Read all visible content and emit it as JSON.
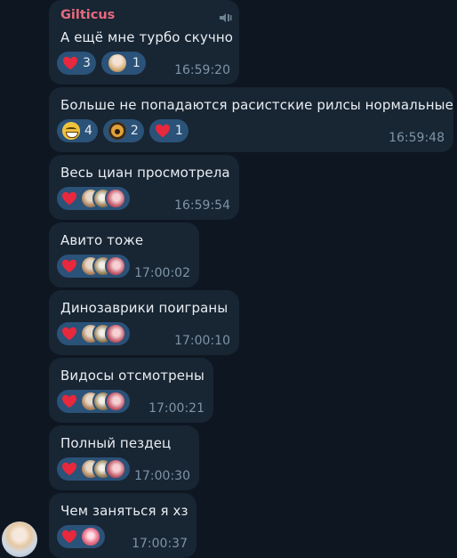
{
  "chat": {
    "sender_name": "Gilticus",
    "messages": [
      {
        "text": "А ещё мне турбо скучно",
        "time": "16:59:20",
        "reactions": [
          {
            "emoji": "heart",
            "count": "3"
          },
          {
            "emoji": "avatar-blonde",
            "count": "1"
          }
        ]
      },
      {
        "text": "Больше не попадаются расистские рилсы нормальные",
        "time": "16:59:48",
        "reactions": [
          {
            "emoji": "grinning-face",
            "count": "4"
          },
          {
            "emoji": "alarm-clock-face",
            "count": "2"
          },
          {
            "emoji": "heart",
            "count": "1"
          }
        ]
      },
      {
        "text": "Весь циан просмотрела",
        "time": "16:59:54",
        "reactions": [
          {
            "emoji": "heart",
            "users": 3
          }
        ]
      },
      {
        "text": "Авито тоже",
        "time": "17:00:02",
        "reactions": [
          {
            "emoji": "heart",
            "users": 3
          }
        ]
      },
      {
        "text": "Динозаврики поиграны",
        "time": "17:00:10",
        "reactions": [
          {
            "emoji": "heart",
            "users": 3
          }
        ]
      },
      {
        "text": "Видосы отсмотрены",
        "time": "17:00:21",
        "reactions": [
          {
            "emoji": "heart",
            "users": 3
          }
        ]
      },
      {
        "text": "Полный пездец",
        "time": "17:00:30",
        "reactions": [
          {
            "emoji": "heart",
            "users": 3
          }
        ]
      },
      {
        "text": "Чем заняться я хз",
        "time": "17:00:37",
        "reactions": [
          {
            "emoji": "heart",
            "users": 1
          }
        ]
      }
    ]
  },
  "colors": {
    "background": "#0e1621",
    "bubble": "#182533",
    "reaction_pill": "#2b5278",
    "sender_name": "#e56a7d",
    "timestamp": "#7e94a6",
    "heart": "#e8283c"
  }
}
